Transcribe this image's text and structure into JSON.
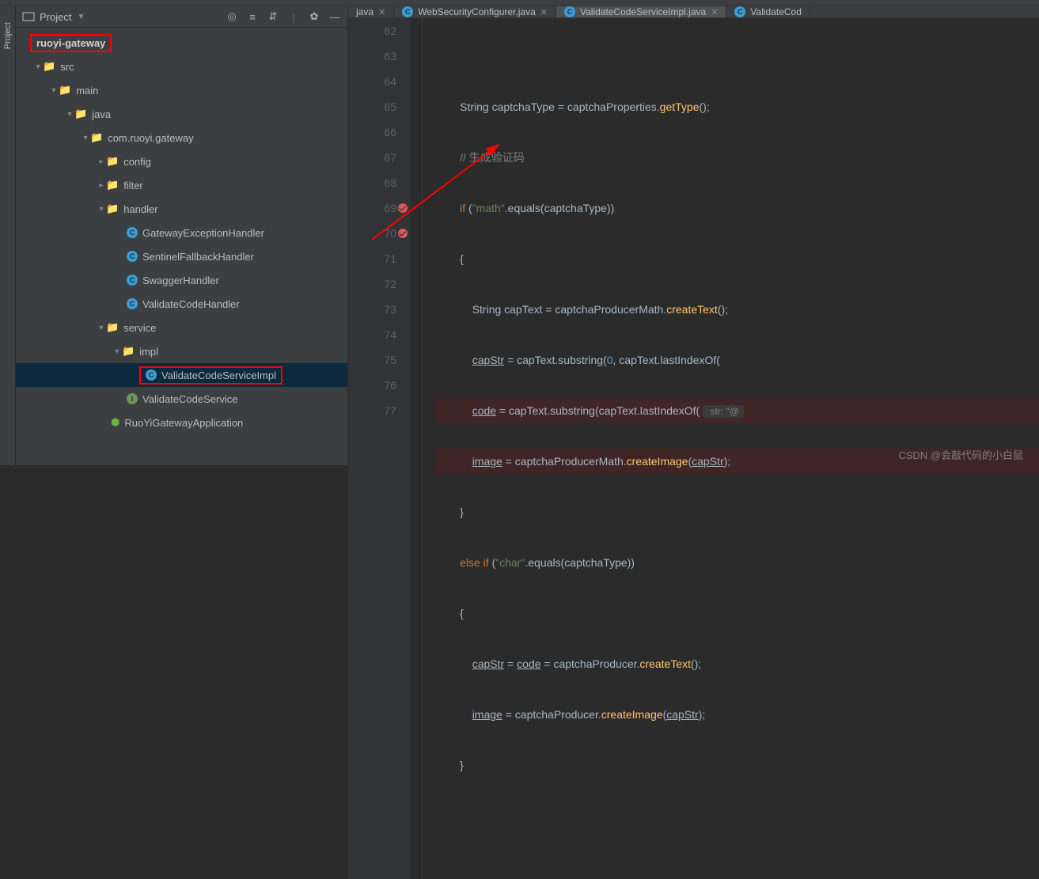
{
  "sidebar_tab": "Project",
  "project_header": {
    "title": "Project"
  },
  "tree": {
    "module": "ruoyi-gateway",
    "src": "src",
    "main": "main",
    "java": "java",
    "pkg": "com.ruoyi.gateway",
    "config": "config",
    "filter": "filter",
    "handler": "handler",
    "h1": "GatewayExceptionHandler",
    "h2": "SentinelFallbackHandler",
    "h3": "SwaggerHandler",
    "h4": "ValidateCodeHandler",
    "service": "service",
    "impl": "impl",
    "impl_class": "ValidateCodeServiceImpl",
    "svc_iface": "ValidateCodeService",
    "app": "RuoYiGatewayApplication"
  },
  "tabs": {
    "t0": "java",
    "t1": "WebSecurityConfigurer.java",
    "t2": "ValidateCodeServiceImpl.java",
    "t3": "ValidateCod"
  },
  "lines": {
    "l62": "62",
    "l63": "63",
    "l64": "64",
    "l65": "65",
    "l66": "66",
    "l67": "67",
    "l68": "68",
    "l69": "69",
    "l70": "70",
    "l71": "71",
    "l72": "72",
    "l73": "73",
    "l74": "74",
    "l75": "75",
    "l76": "76",
    "l77": "77"
  },
  "code": {
    "c63a": "String captchaType = captchaProperties.",
    "c63b": "getType",
    "c63c": "();",
    "c64a": "// ",
    "c64b": "生成验证码",
    "c65a": "if ",
    "c65b": "(",
    "c65c": "\"math\"",
    "c65d": ".equals(captchaType))",
    "c66": "{",
    "c67a": "String capText = captchaProducerMath.",
    "c67b": "createText",
    "c67c": "();",
    "c68a": "capStr",
    "c68b": " = capText.substring(",
    "c68c": "0",
    "c68d": ", capText.lastIndexOf(",
    "c69a": "code",
    "c69b": " = capText.substring(capText.lastIndexOf(",
    "c69hint": " str: \"@",
    "c70a": "image",
    "c70b": " = captchaProducerMath.",
    "c70c": "createImage",
    "c70d": "(",
    "c70e": "capStr",
    "c70f": ");",
    "c71": "}",
    "c72a": "else if ",
    "c72b": "(",
    "c72c": "\"char\"",
    "c72d": ".equals(captchaType))",
    "c73": "{",
    "c74a": "capStr",
    "c74b": " = ",
    "c74c": "code",
    "c74d": " = captchaProducer.",
    "c74e": "createText",
    "c74f": "();",
    "c75a": "image",
    "c75b": " = captchaProducer.",
    "c75c": "createImage",
    "c75d": "(",
    "c75e": "capStr",
    "c75f": ");",
    "c76": "}"
  },
  "watermark": "CSDN @会敲代码的小白鼠"
}
